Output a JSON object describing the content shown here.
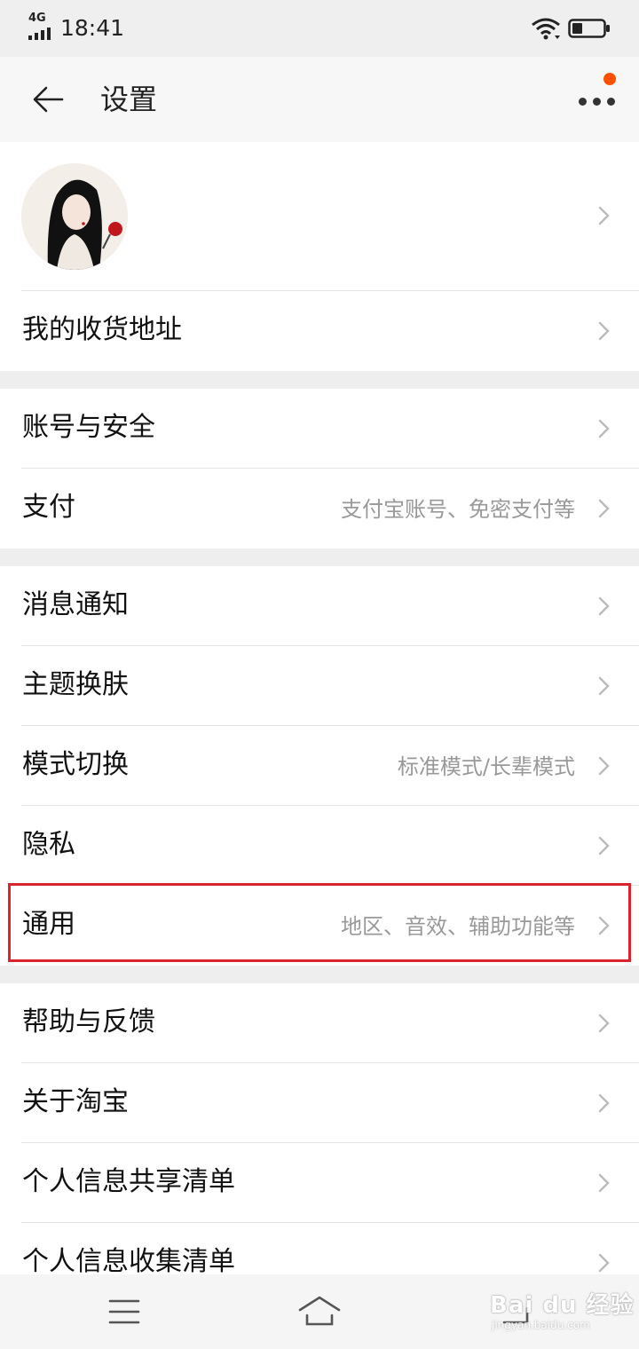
{
  "status_bar": {
    "network": "4G",
    "time": "18:41"
  },
  "header": {
    "title": "设置"
  },
  "rows": {
    "address": {
      "label": "我的收货地址"
    },
    "account": {
      "label": "账号与安全"
    },
    "payment": {
      "label": "支付",
      "hint": "支付宝账号、免密支付等"
    },
    "notify": {
      "label": "消息通知"
    },
    "theme": {
      "label": "主题换肤"
    },
    "mode": {
      "label": "模式切换",
      "hint": "标准模式/长辈模式"
    },
    "privacy": {
      "label": "隐私"
    },
    "general": {
      "label": "通用",
      "hint": "地区、音效、辅助功能等"
    },
    "help": {
      "label": "帮助与反馈"
    },
    "about": {
      "label": "关于淘宝"
    },
    "share_list": {
      "label": "个人信息共享清单"
    },
    "collect_list": {
      "label": "个人信息收集清单"
    }
  },
  "watermark": {
    "text": "Bai du 经验",
    "sub": "jingyan.baidu.com"
  },
  "colors": {
    "accent": "#ff5000",
    "highlight": "#d9232e"
  }
}
